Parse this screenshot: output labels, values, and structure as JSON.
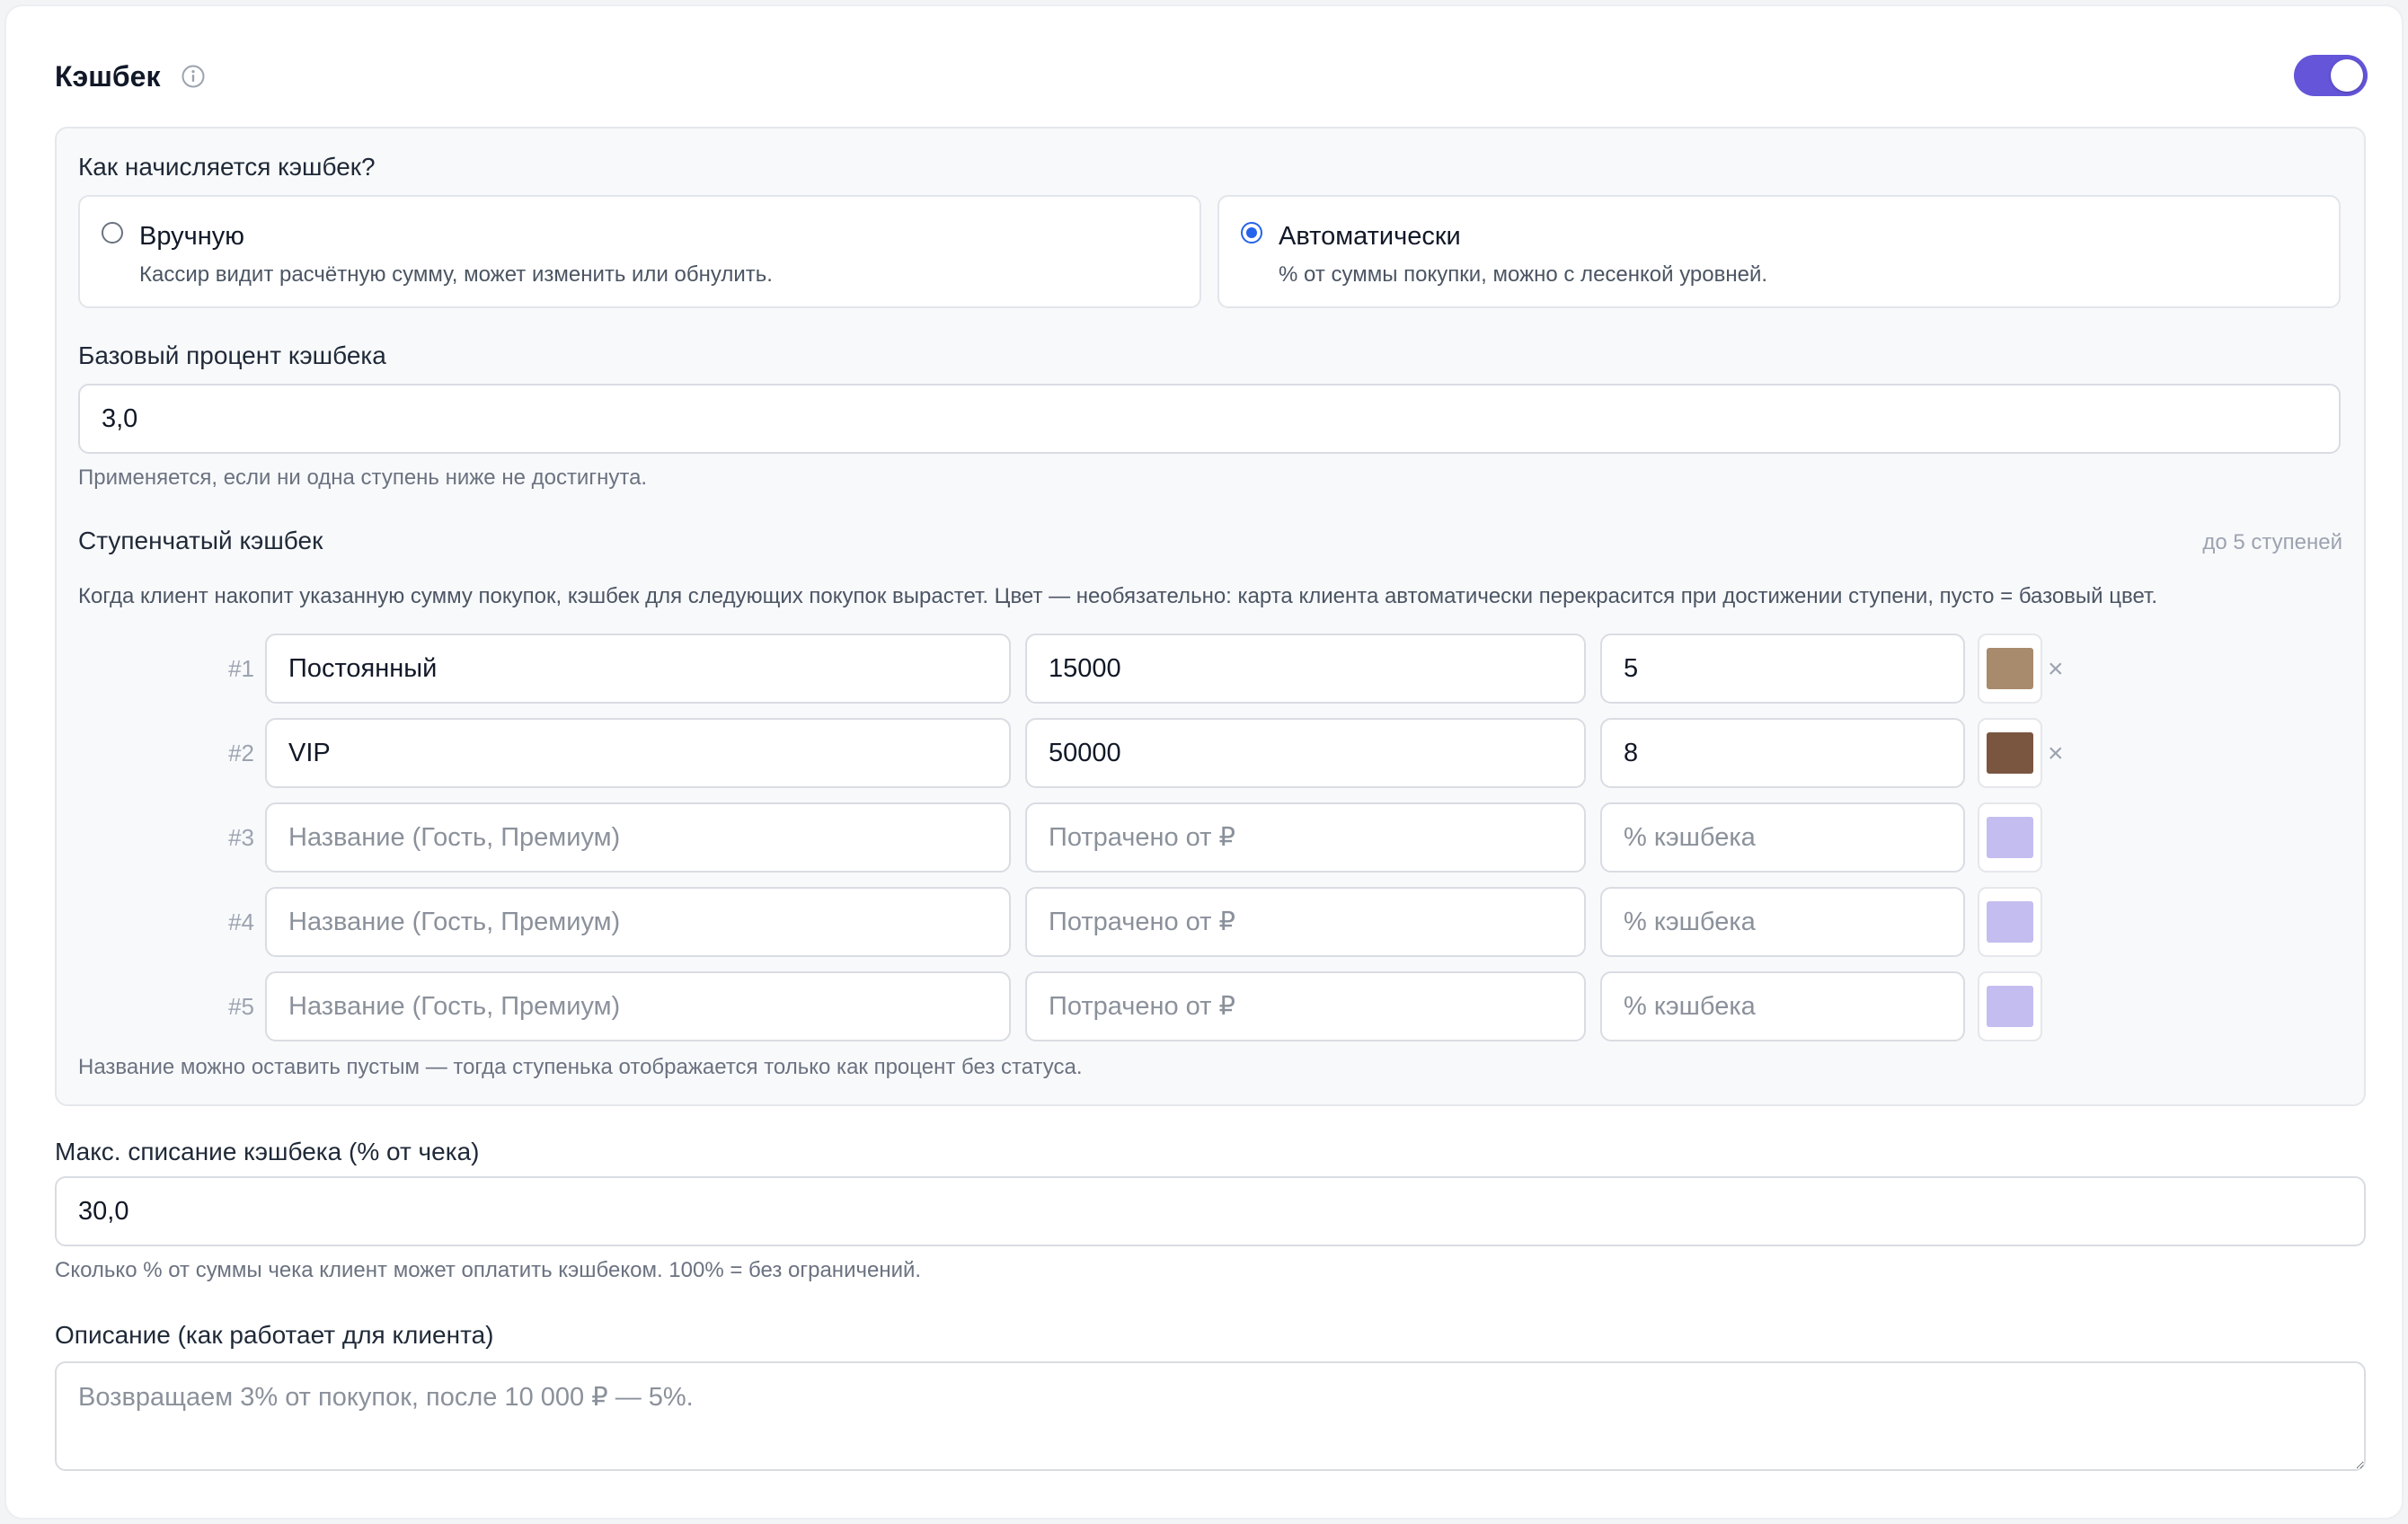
{
  "header": {
    "title": "Кэшбек",
    "info_icon": "info-circle-icon",
    "enabled": true
  },
  "accrual": {
    "question": "Как начисляется кэшбек?",
    "options": [
      {
        "title": "Вручную",
        "description": "Кассир видит расчётную сумму, может изменить или обнулить.",
        "selected": false
      },
      {
        "title": "Автоматически",
        "description": "% от суммы покупки, можно с лесенкой уровней.",
        "selected": true
      }
    ]
  },
  "base_percent": {
    "label": "Базовый процент кэшбека",
    "value": "3,0",
    "hint": "Применяется, если ни одна ступень ниже не достигнута."
  },
  "tiers": {
    "title": "Ступенчатый кэшбек",
    "limit": "до 5 ступеней",
    "description": "Когда клиент накопит указанную сумму покупок, кэшбек для следующих покупок вырастет. Цвет — необязательно: карта клиента автоматически перекрасится при достижении ступени, пусто = базовый цвет.",
    "placeholders": {
      "name": "Название (Гость, Премиум)",
      "spent": "Потрачено от ₽",
      "percent": "% кэшбека"
    },
    "remove_icon": "close-icon",
    "rows": [
      {
        "num": "#1",
        "name": "Постоянный",
        "spent": "15000",
        "percent": "5",
        "color": "#a88a6d",
        "removable": true
      },
      {
        "num": "#2",
        "name": "VIP",
        "spent": "50000",
        "percent": "8",
        "color": "#7a5640",
        "removable": true
      },
      {
        "num": "#3",
        "name": "",
        "spent": "",
        "percent": "",
        "color": "#c4bdf0",
        "removable": false
      },
      {
        "num": "#4",
        "name": "",
        "spent": "",
        "percent": "",
        "color": "#c4bdf0",
        "removable": false
      },
      {
        "num": "#5",
        "name": "",
        "spent": "",
        "percent": "",
        "color": "#c4bdf0",
        "removable": false
      }
    ],
    "footnote": "Название можно оставить пустым — тогда ступенька отображается только как процент без статуса."
  },
  "max_writeoff": {
    "label": "Макс. списание кэшбека (% от чека)",
    "value": "30,0",
    "hint": "Сколько % от суммы чека клиент может оплатить кэшбеком. 100% = без ограничений."
  },
  "client_description": {
    "label": "Описание (как работает для клиента)",
    "placeholder": "Возвращаем 3% от покупок, после 10 000 ₽ — 5%."
  },
  "colors": {
    "accent": "#6455d9",
    "radio": "#2563eb"
  }
}
